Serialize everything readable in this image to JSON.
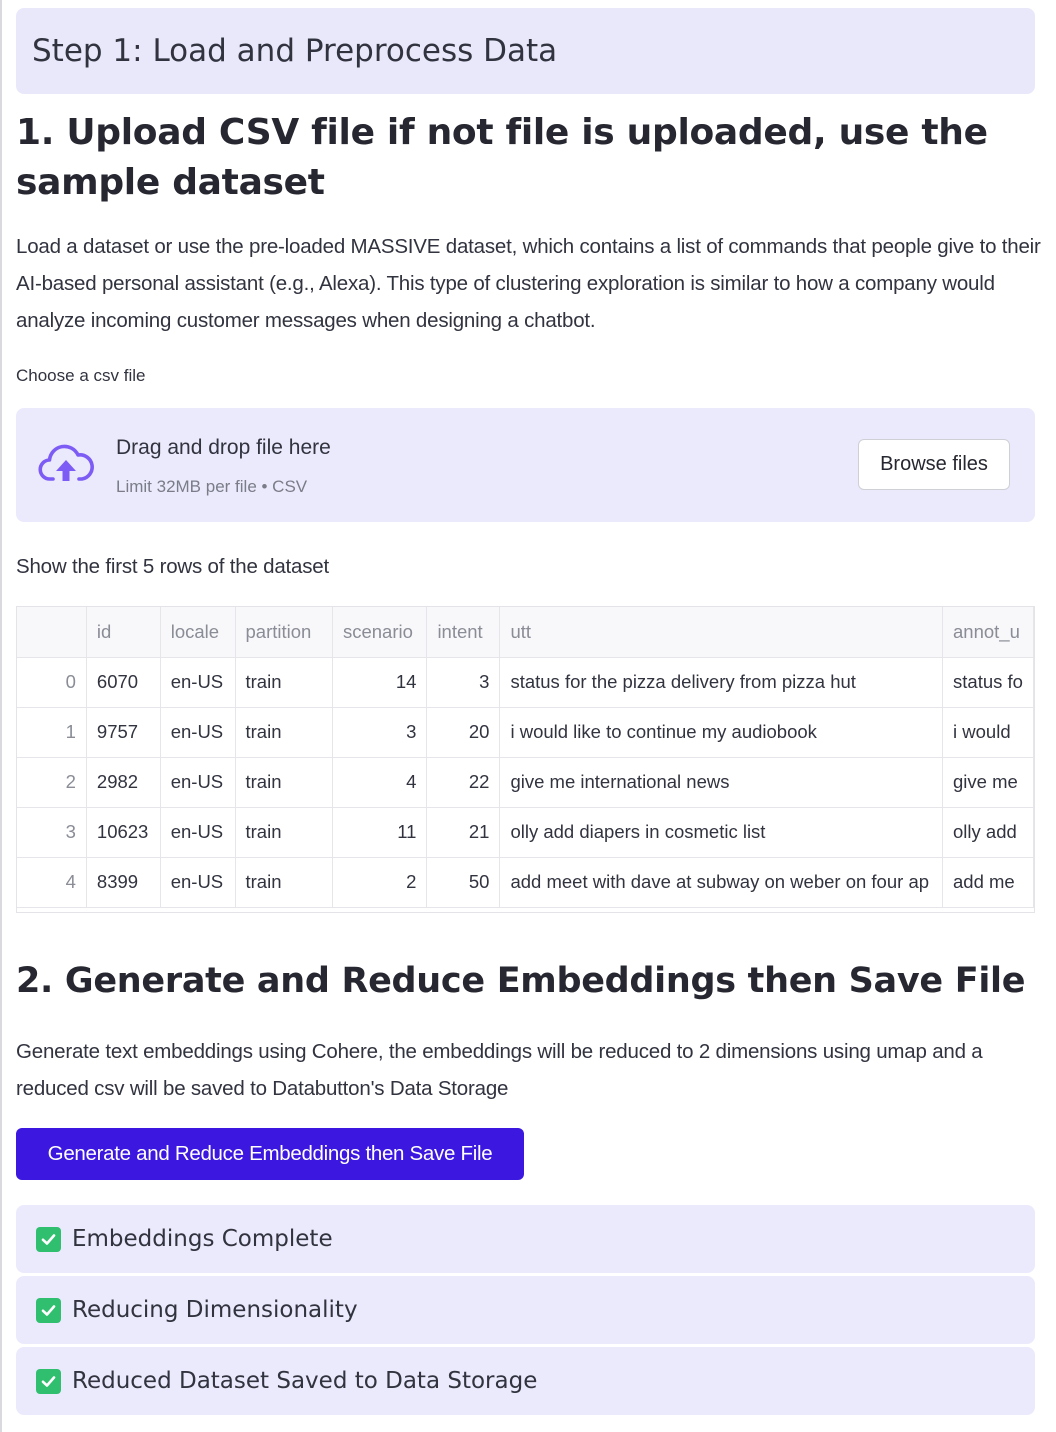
{
  "step_header": "Step 1: Load and Preprocess Data",
  "section1": {
    "title": "1. Upload CSV file if not file is uploaded, use the sample dataset",
    "description": "Load a dataset or use the pre-loaded MASSIVE dataset, which contains a list of commands that people give to their AI-based personal assistant (e.g., Alexa). This type of clustering exploration is similar to how a company would analyze incoming customer messages when designing a chatbot."
  },
  "uploader": {
    "label": "Choose a csv file",
    "drag_text": "Drag and drop file here",
    "limit_text": "Limit 32MB per file • CSV",
    "browse_label": "Browse files",
    "icon": "cloud-upload-icon",
    "accent": "#7c5cf5"
  },
  "table": {
    "caption": "Show the first 5 rows of the dataset",
    "columns": [
      "",
      "id",
      "locale",
      "partition",
      "scenario",
      "intent",
      "utt",
      "annot_u"
    ],
    "rows": [
      [
        "0",
        "6070",
        "en-US",
        "train",
        "14",
        "3",
        "status for the pizza delivery from pizza hut",
        "status fo"
      ],
      [
        "1",
        "9757",
        "en-US",
        "train",
        "3",
        "20",
        "i would like to continue my audiobook",
        "i would"
      ],
      [
        "2",
        "2982",
        "en-US",
        "train",
        "4",
        "22",
        "give me international news",
        "give me"
      ],
      [
        "3",
        "10623",
        "en-US",
        "train",
        "11",
        "21",
        "olly add diapers in cosmetic list",
        "olly add"
      ],
      [
        "4",
        "8399",
        "en-US",
        "train",
        "2",
        "50",
        "add meet with dave at subway on weber on four ap",
        "add me"
      ]
    ]
  },
  "section2": {
    "title": "2. Generate and Reduce Embeddings then Save File",
    "description": "Generate text embeddings using Cohere, the embeddings will be reduced to 2 dimensions using umap and a reduced csv will be saved to Databutton's Data Storage",
    "button_label": "Generate and Reduce Embeddings then Save File",
    "button_color": "#3c17e0"
  },
  "statuses": [
    {
      "label": "Embeddings Complete",
      "icon": "check-icon"
    },
    {
      "label": "Reducing Dimensionality",
      "icon": "check-icon"
    },
    {
      "label": "Reduced Dataset Saved to Data Storage",
      "icon": "check-icon"
    }
  ]
}
